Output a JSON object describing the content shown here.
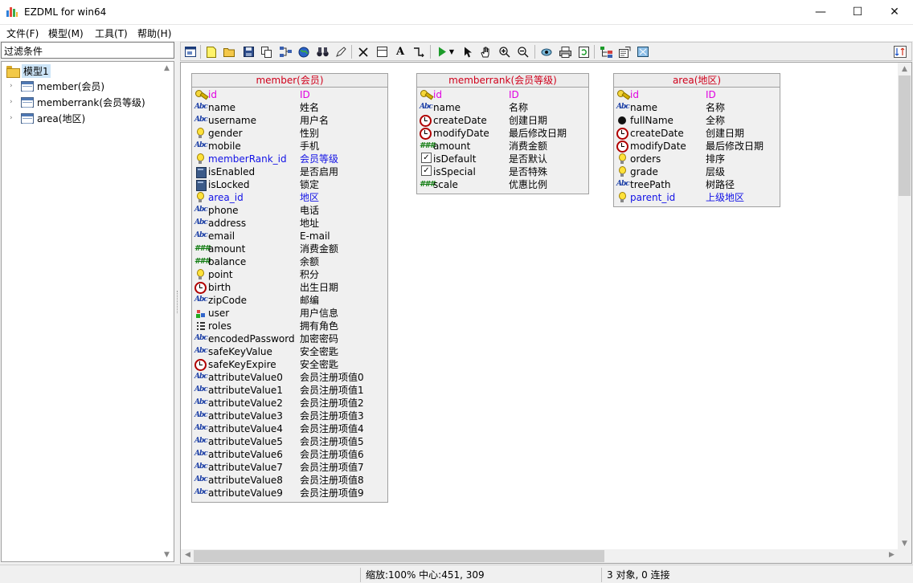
{
  "window": {
    "title": "EZDML for win64",
    "controls": {
      "minimize": "—",
      "maximize": "☐",
      "close": "✕"
    }
  },
  "menu": [
    "文件(F)",
    "模型(M)",
    "工具(T)",
    "帮助(H)"
  ],
  "left_panel": {
    "filter_label": "过滤条件",
    "tree": {
      "root": "模型1",
      "items": [
        "member(会员)",
        "memberrank(会员等级)",
        "area(地区)"
      ]
    }
  },
  "toolbar_icons": [
    "layout-icon",
    "new-icon",
    "open-icon",
    "save-icon",
    "copy-icon",
    "network-icon",
    "globe-icon",
    "binoculars-icon",
    "pen-icon",
    "delete-icon",
    "table-icon",
    "text-icon",
    "link-icon",
    "run-icon",
    "dropdown-icon",
    "pointer-icon",
    "hand-icon",
    "zoom-in-icon",
    "zoom-out-icon",
    "eye-icon",
    "printer-icon",
    "refresh-icon",
    "tree-icon",
    "properties-icon",
    "fit-icon",
    "swap-icon"
  ],
  "entities": [
    {
      "title": "member(会员)",
      "fields": [
        {
          "name": "id",
          "label": "ID",
          "icon": "key",
          "style": "pk"
        },
        {
          "name": "name",
          "label": "姓名",
          "icon": "abc"
        },
        {
          "name": "username",
          "label": "用户名",
          "icon": "abc"
        },
        {
          "name": "gender",
          "label": "性别",
          "icon": "bulb"
        },
        {
          "name": "mobile",
          "label": "手机",
          "icon": "abc"
        },
        {
          "name": "memberRank_id",
          "label": "会员等级",
          "icon": "bulb",
          "style": "fk"
        },
        {
          "name": "isEnabled",
          "label": "是否启用",
          "icon": "bool"
        },
        {
          "name": "isLocked",
          "label": "锁定",
          "icon": "bool"
        },
        {
          "name": "area_id",
          "label": "地区",
          "icon": "bulb",
          "style": "fk"
        },
        {
          "name": "phone",
          "label": "电话",
          "icon": "abc"
        },
        {
          "name": "address",
          "label": "地址",
          "icon": "abc"
        },
        {
          "name": "email",
          "label": "E-mail",
          "icon": "abc"
        },
        {
          "name": "amount",
          "label": "消费金额",
          "icon": "num"
        },
        {
          "name": "balance",
          "label": "余额",
          "icon": "num"
        },
        {
          "name": "point",
          "label": "积分",
          "icon": "bulb"
        },
        {
          "name": "birth",
          "label": "出生日期",
          "icon": "clock"
        },
        {
          "name": "zipCode",
          "label": "邮编",
          "icon": "abc"
        },
        {
          "name": "user",
          "label": "用户信息",
          "icon": "obj"
        },
        {
          "name": "roles",
          "label": "拥有角色",
          "icon": "list"
        },
        {
          "name": "encodedPassword",
          "label": "加密密码",
          "icon": "abc"
        },
        {
          "name": "safeKeyValue",
          "label": "安全密匙",
          "icon": "abc"
        },
        {
          "name": "safeKeyExpire",
          "label": "安全密匙",
          "icon": "clock"
        },
        {
          "name": "attributeValue0",
          "label": "会员注册项值0",
          "icon": "abc"
        },
        {
          "name": "attributeValue1",
          "label": "会员注册项值1",
          "icon": "abc"
        },
        {
          "name": "attributeValue2",
          "label": "会员注册项值2",
          "icon": "abc"
        },
        {
          "name": "attributeValue3",
          "label": "会员注册项值3",
          "icon": "abc"
        },
        {
          "name": "attributeValue4",
          "label": "会员注册项值4",
          "icon": "abc"
        },
        {
          "name": "attributeValue5",
          "label": "会员注册项值5",
          "icon": "abc"
        },
        {
          "name": "attributeValue6",
          "label": "会员注册项值6",
          "icon": "abc"
        },
        {
          "name": "attributeValue7",
          "label": "会员注册项值7",
          "icon": "abc"
        },
        {
          "name": "attributeValue8",
          "label": "会员注册项值8",
          "icon": "abc"
        },
        {
          "name": "attributeValue9",
          "label": "会员注册项值9",
          "icon": "abc"
        }
      ]
    },
    {
      "title": "memberrank(会员等级)",
      "fields": [
        {
          "name": "id",
          "label": "ID",
          "icon": "key",
          "style": "pk"
        },
        {
          "name": "name",
          "label": "名称",
          "icon": "abc"
        },
        {
          "name": "createDate",
          "label": "创建日期",
          "icon": "clock"
        },
        {
          "name": "modifyDate",
          "label": "最后修改日期",
          "icon": "clock"
        },
        {
          "name": "amount",
          "label": "消费金额",
          "icon": "num"
        },
        {
          "name": "isDefault",
          "label": "是否默认",
          "icon": "check"
        },
        {
          "name": "isSpecial",
          "label": "是否特殊",
          "icon": "check"
        },
        {
          "name": "scale",
          "label": "优惠比例",
          "icon": "num"
        }
      ]
    },
    {
      "title": "area(地区)",
      "fields": [
        {
          "name": "id",
          "label": "ID",
          "icon": "key",
          "style": "pk"
        },
        {
          "name": "name",
          "label": "名称",
          "icon": "abc"
        },
        {
          "name": "fullName",
          "label": "全称",
          "icon": "dot"
        },
        {
          "name": "createDate",
          "label": "创建日期",
          "icon": "clock"
        },
        {
          "name": "modifyDate",
          "label": "最后修改日期",
          "icon": "clock"
        },
        {
          "name": "orders",
          "label": "排序",
          "icon": "bulb"
        },
        {
          "name": "grade",
          "label": "层级",
          "icon": "bulb"
        },
        {
          "name": "treePath",
          "label": "树路径",
          "icon": "abc"
        },
        {
          "name": "parent_id",
          "label": "上级地区",
          "icon": "bulb",
          "style": "fk"
        }
      ]
    }
  ],
  "status": {
    "zoom": "缩放:100% 中心:451, 309",
    "summary": "3 对象, 0 连接"
  }
}
